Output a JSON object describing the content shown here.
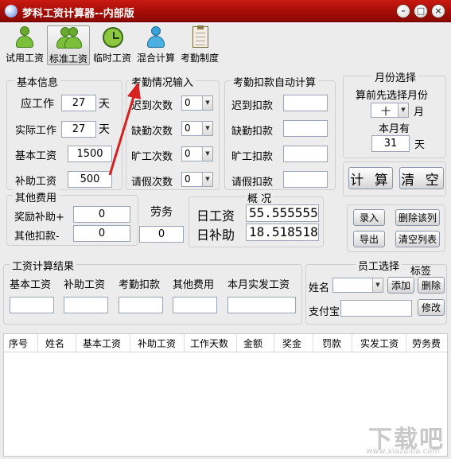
{
  "window": {
    "title": "梦科工资计算器--内部版",
    "minimize_glyph": "–",
    "maximize_glyph": "□",
    "close_glyph": "×"
  },
  "toolbar": [
    {
      "label": "试用工资",
      "icon": "person-icon"
    },
    {
      "label": "标准工资",
      "icon": "person-icon",
      "active": true
    },
    {
      "label": "临时工资",
      "icon": "clock-icon"
    },
    {
      "label": "混合计算",
      "icon": "people-icon"
    },
    {
      "label": "考勤制度",
      "icon": "clipboard-icon"
    }
  ],
  "basic_info": {
    "title": "基本信息",
    "work_days_label": "应工作",
    "work_days_value": "27",
    "work_days_unit": "天",
    "actual_days_label": "实际工作",
    "actual_days_value": "27",
    "actual_days_unit": "天",
    "base_salary_label": "基本工资",
    "base_salary_value": "1500",
    "subsidy_label": "补助工资",
    "subsidy_value": "500"
  },
  "attendance_input": {
    "title": "考勤情况输入",
    "late_label": "迟到次数",
    "late_value": "0",
    "absent_label": "缺勤次数",
    "absent_value": "0",
    "truancy_label": "旷工次数",
    "truancy_value": "0",
    "leave_label": "请假次数",
    "leave_value": "0"
  },
  "attendance_deduction": {
    "title": "考勤扣款自动计算",
    "late_label": "迟到扣款",
    "absent_label": "缺勤扣款",
    "truancy_label": "旷工扣款",
    "leave_label": "请假扣款"
  },
  "month_select": {
    "title": "月份选择",
    "hint": "算前先选择月份",
    "month_value": "十",
    "month_unit": "月",
    "days_label": "本月有",
    "days_value": "31",
    "days_unit": "天"
  },
  "actions": {
    "calculate": "计 算",
    "clear": "清 空",
    "import": "录入",
    "delete_row": "删除该列",
    "export": "导出",
    "clear_list": "清空列表"
  },
  "other_fees": {
    "title": "其他费用",
    "bonus_label": "奖励补助+",
    "bonus_value": "0",
    "deduct_label": "其他扣款-",
    "deduct_value": "0",
    "labor_label": "劳务",
    "labor_value": "0"
  },
  "overview": {
    "title": "概 况",
    "daily_wage_label": "日工资",
    "daily_wage_value": "55.555555",
    "daily_subsidy_label": "日补助",
    "daily_subsidy_value": "18.518518"
  },
  "results": {
    "title": "工资计算结果",
    "base_label": "基本工资",
    "subsidy_label": "补助工资",
    "attendance_label": "考勤扣款",
    "other_label": "其他费用",
    "actual_label": "本月实发工资"
  },
  "employee": {
    "title": "员工选择",
    "tag_label": "标签",
    "name_label": "姓名",
    "add_button": "添加",
    "delete_button": "删除",
    "alipay_label": "支付宝",
    "edit_button": "修改"
  },
  "table": {
    "columns": [
      "序号",
      "姓名",
      "基本工资",
      "补助工资",
      "工作天数",
      "金额",
      "奖金",
      "罚款",
      "实发工资",
      "劳务费"
    ]
  },
  "watermark": {
    "text": "下载吧",
    "sub": "www.xiazaiba.com"
  },
  "colors": {
    "titlebar": "#b01208",
    "annotation_arrow": "#d82020"
  }
}
